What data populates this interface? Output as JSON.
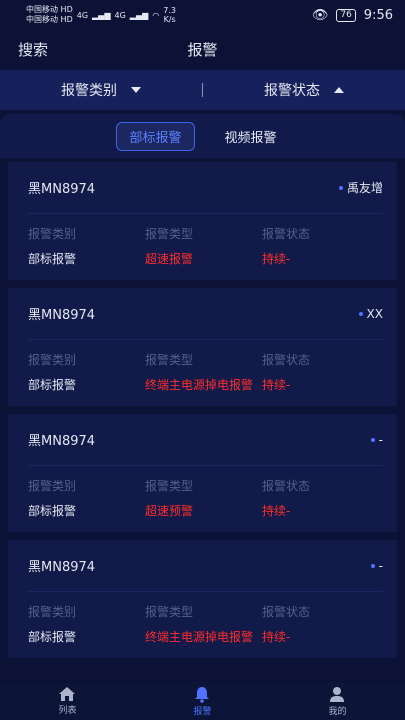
{
  "status": {
    "carrier1": "中国移动",
    "carrier2": "中国移动",
    "hd": "HD",
    "signal1": "4G",
    "signal2": "4G",
    "speed_value": "7.3",
    "speed_unit": "K/s",
    "battery": "76",
    "time": "9:56"
  },
  "nav": {
    "search": "搜索",
    "title": "报警"
  },
  "filter": {
    "category": "报警类别",
    "state": "报警状态"
  },
  "tabs": [
    {
      "label": "部标报警",
      "active": true
    },
    {
      "label": "视频报警",
      "active": false
    }
  ],
  "labels": {
    "category": "报警类别",
    "type": "报警类型",
    "state": "报警状态"
  },
  "cards": [
    {
      "plate": "黑MN8974",
      "owner": "禹友增",
      "category": "部标报警",
      "type": "超速报警",
      "state": "持续-"
    },
    {
      "plate": "黑MN8974",
      "owner": "XX",
      "category": "部标报警",
      "type": "终端主电源掉电报警",
      "state": "持续-"
    },
    {
      "plate": "黑MN8974",
      "owner": "-",
      "category": "部标报警",
      "type": "超速预警",
      "state": "持续-"
    },
    {
      "plate": "黑MN8974",
      "owner": "-",
      "category": "部标报警",
      "type": "终端主电源掉电报警",
      "state": "持续-"
    }
  ],
  "bottom_nav": [
    {
      "label": "列表",
      "icon": "home-icon",
      "active": false
    },
    {
      "label": "报警",
      "icon": "bell-icon",
      "active": true
    },
    {
      "label": "我的",
      "icon": "user-icon",
      "active": false
    }
  ],
  "colors": {
    "accent": "#4f73ff",
    "alarm": "#ff2d2d",
    "background": "#0b1236"
  }
}
